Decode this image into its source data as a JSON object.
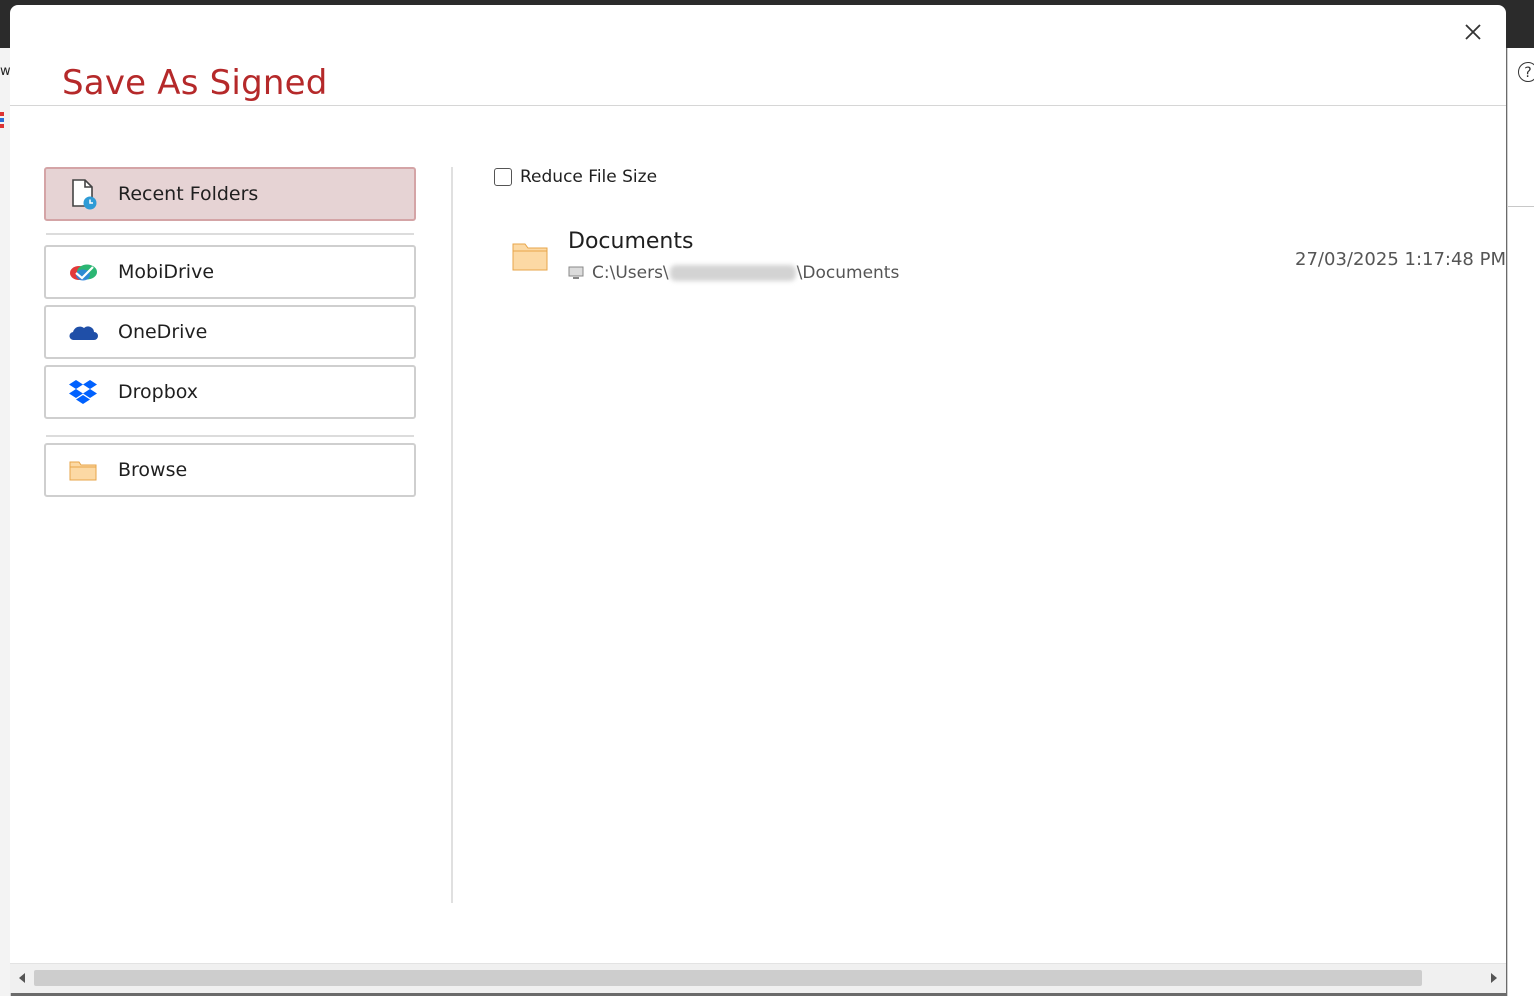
{
  "dialog": {
    "title": "Save As Signed",
    "close_icon": "close-icon",
    "accent_color": "#b5292a"
  },
  "sidebar": {
    "items": [
      {
        "label": "Recent Folders",
        "icon": "recent-document-icon",
        "active": true
      },
      {
        "label": "MobiDrive",
        "icon": "mobidrive-icon",
        "active": false
      },
      {
        "label": "OneDrive",
        "icon": "onedrive-icon",
        "active": false
      },
      {
        "label": "Dropbox",
        "icon": "dropbox-icon",
        "active": false
      },
      {
        "label": "Browse",
        "icon": "folder-icon",
        "active": false
      }
    ]
  },
  "options": {
    "reduce_file_size_label": "Reduce File Size",
    "reduce_file_size_checked": false
  },
  "recent_folders": [
    {
      "name": "Documents",
      "path_prefix": "C:\\Users\\",
      "path_suffix": "\\Documents",
      "date": "27/03/2025 1:17:48 PM",
      "icon": "folder-icon",
      "location_icon": "computer-icon"
    }
  ]
}
